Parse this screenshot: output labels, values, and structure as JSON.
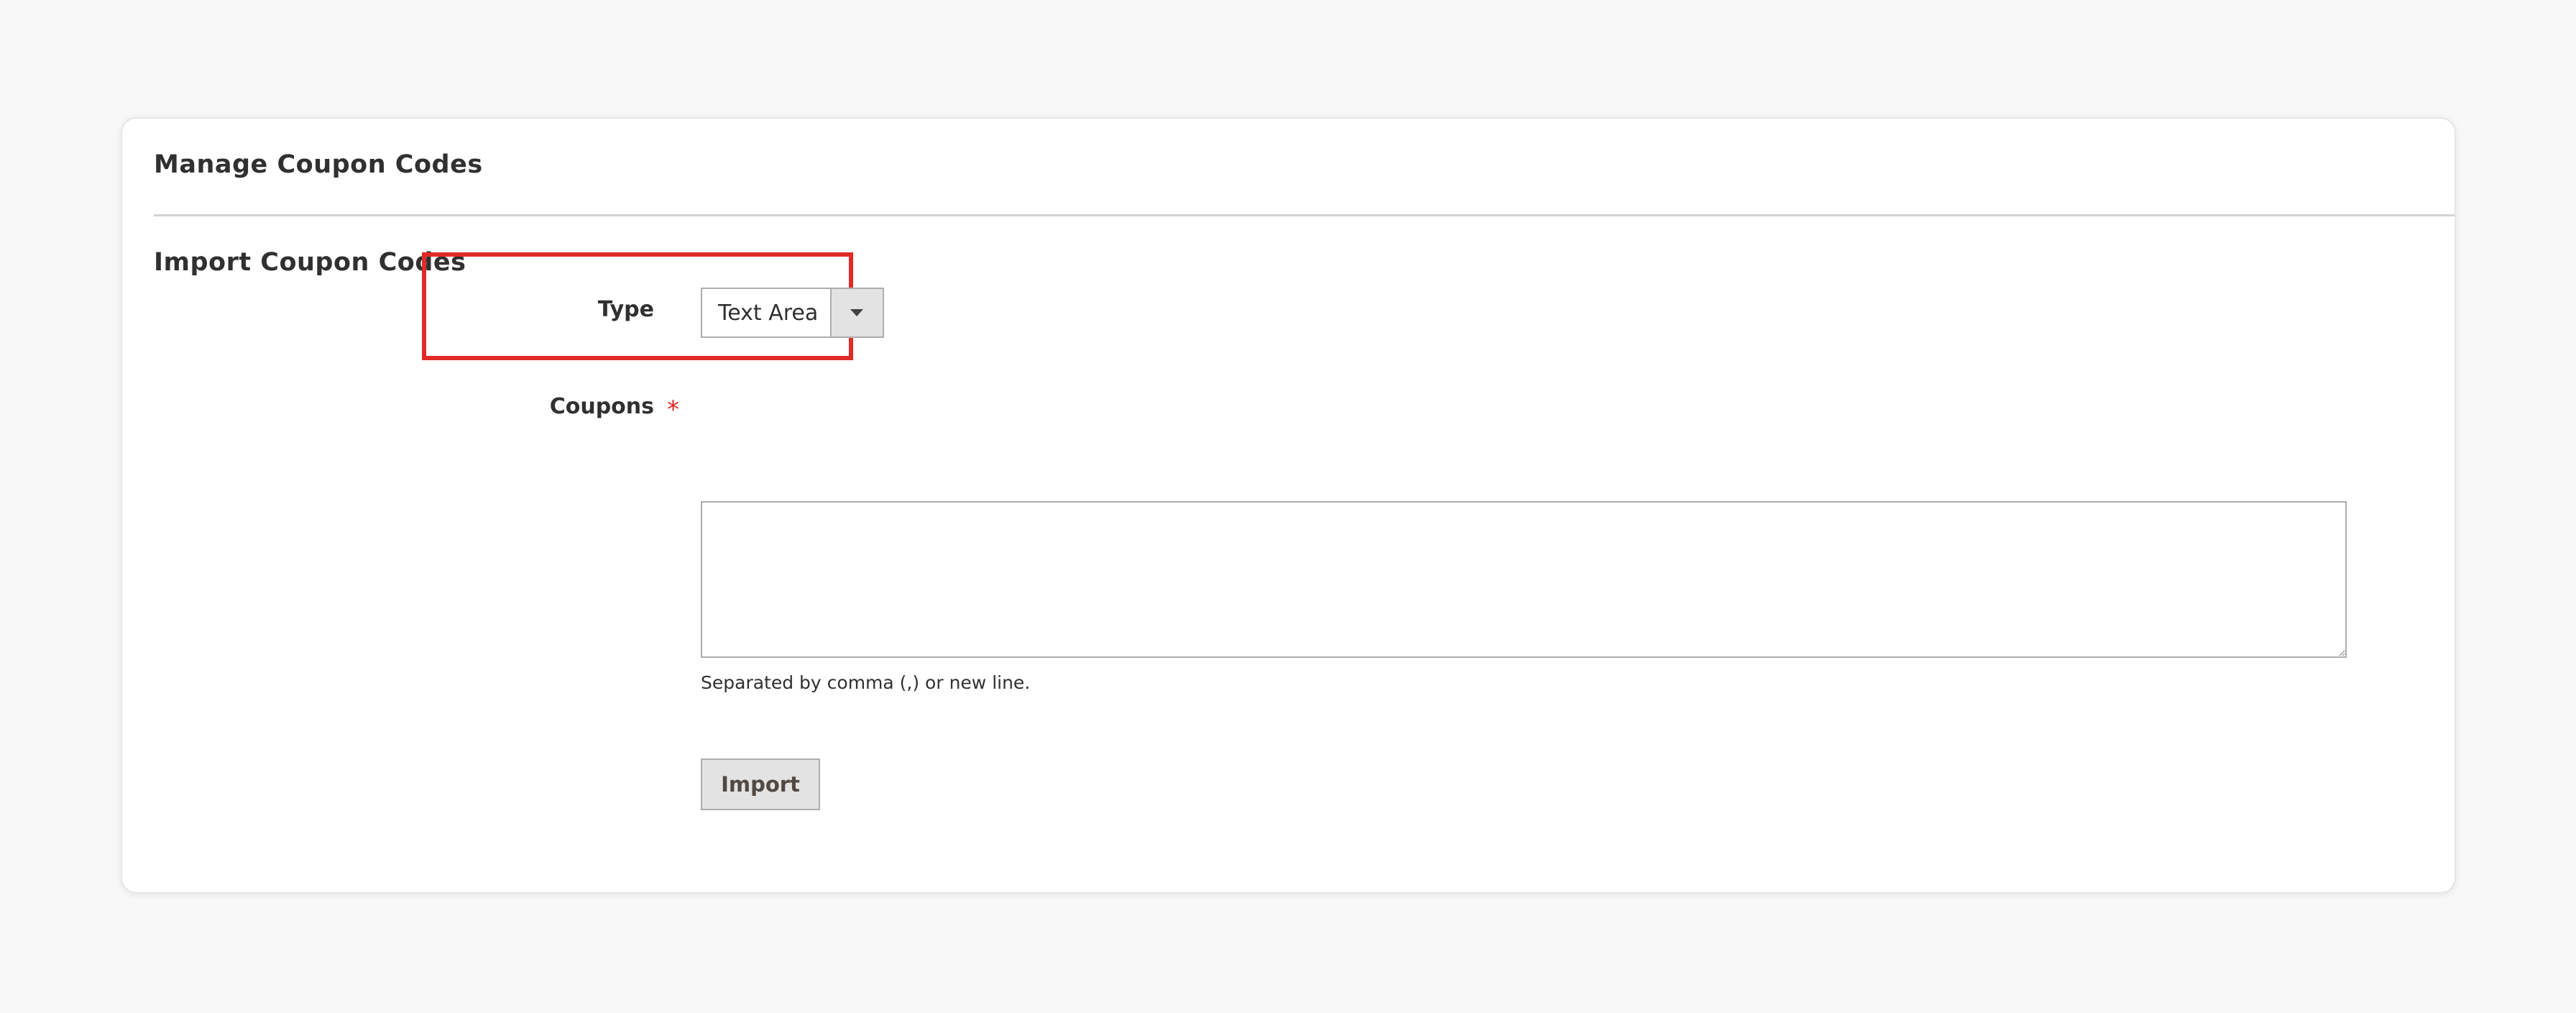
{
  "page": {
    "card_title": "Manage Coupon Codes",
    "section_title": "Import Coupon Codes"
  },
  "form": {
    "type_label": "Type",
    "type_value": "Text Area",
    "coupons_label": "Coupons",
    "required_marker": "*",
    "coupons_value": "",
    "note": "Separated by comma (,) or new line.",
    "import_label": "Import"
  },
  "icons": {
    "select_arrow": "chevron-down-icon"
  },
  "colors": {
    "highlight": "#e02b27",
    "required": "#e22626",
    "button_bg": "#e3e3e3"
  }
}
